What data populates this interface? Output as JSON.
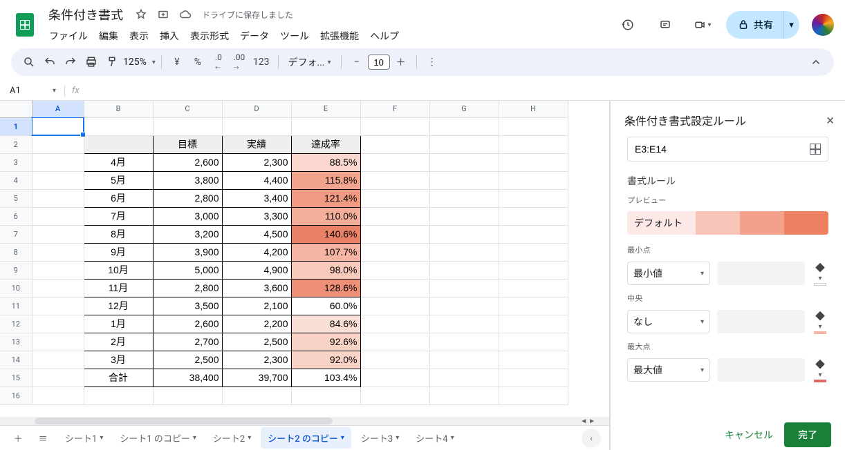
{
  "header": {
    "doc_title": "条件付き書式",
    "drive_status": "ドライブに保存しました",
    "menus": [
      "ファイル",
      "編集",
      "表示",
      "挿入",
      "表示形式",
      "データ",
      "ツール",
      "拡張機能",
      "ヘルプ"
    ],
    "share_label": "共有"
  },
  "toolbar": {
    "zoom": "125%",
    "currency": "¥",
    "percent": "%",
    "dec_dec": ".0",
    "inc_dec": ".00",
    "format123": "123",
    "font": "デフォ...",
    "font_size": "10"
  },
  "namebox": {
    "cell": "A1",
    "fx": "fx"
  },
  "columns": [
    "A",
    "B",
    "C",
    "D",
    "E",
    "F",
    "G",
    "H"
  ],
  "col_widths": {
    "A": 75,
    "B": 100,
    "C": 100,
    "D": 100,
    "E": 100,
    "F": 100,
    "G": 100,
    "H": 100
  },
  "row_count": 16,
  "selected_cell": "A1",
  "table": {
    "headers": {
      "C": "目標",
      "D": "実績",
      "E": "達成率"
    },
    "header_row": 2,
    "data_start_row": 3,
    "rows": [
      {
        "b": "4月",
        "c": "2,600",
        "d": "2,300",
        "e": "88.5%",
        "shade": "#f9d7ce"
      },
      {
        "b": "5月",
        "c": "3,800",
        "d": "4,400",
        "e": "115.8%",
        "shade": "#f2a48f"
      },
      {
        "b": "6月",
        "c": "2,800",
        "d": "3,400",
        "e": "121.4%",
        "shade": "#f09a83"
      },
      {
        "b": "7月",
        "c": "3,000",
        "d": "3,300",
        "e": "110.0%",
        "shade": "#f4af9b"
      },
      {
        "b": "8月",
        "c": "3,200",
        "d": "4,500",
        "e": "140.6%",
        "shade": "#ea8267"
      },
      {
        "b": "9月",
        "c": "3,900",
        "d": "4,200",
        "e": "107.7%",
        "shade": "#f5b5a2"
      },
      {
        "b": "10月",
        "c": "5,000",
        "d": "4,900",
        "e": "98.0%",
        "shade": "#f8cabb"
      },
      {
        "b": "11月",
        "c": "2,800",
        "d": "3,600",
        "e": "128.6%",
        "shade": "#ee9078"
      },
      {
        "b": "12月",
        "c": "3,500",
        "d": "2,100",
        "e": "60.0%",
        "shade": "#ffffff"
      },
      {
        "b": "1月",
        "c": "2,600",
        "d": "2,200",
        "e": "84.6%",
        "shade": "#fadfd6"
      },
      {
        "b": "2月",
        "c": "2,700",
        "d": "2,500",
        "e": "92.6%",
        "shade": "#f9d2c6"
      },
      {
        "b": "3月",
        "c": "2,500",
        "d": "2,300",
        "e": "92.0%",
        "shade": "#f9d3c7"
      },
      {
        "b": "合計",
        "c": "38,400",
        "d": "39,700",
        "e": "103.4%",
        "shade": "#ffffff"
      }
    ]
  },
  "sheet_tabs": [
    {
      "label": "シート1",
      "active": false
    },
    {
      "label": "シート1 のコピー",
      "active": false
    },
    {
      "label": "シート2",
      "active": false
    },
    {
      "label": "シート2 のコピー",
      "active": true
    },
    {
      "label": "シート3",
      "active": false
    },
    {
      "label": "シート4",
      "active": false
    }
  ],
  "sidebar": {
    "title": "条件付き書式設定ルール",
    "range": "E3:E14",
    "rule_section": "書式ルール",
    "preview_label": "プレビュー",
    "default_label": "デフォルト",
    "gradient": [
      "#fce8e6",
      "#f8c4b8",
      "#f3a18d",
      "#ee8062"
    ],
    "min_label": "最小点",
    "min_select": "最小値",
    "mid_label": "中央",
    "mid_select": "なし",
    "max_label": "最大点",
    "max_select": "最大値",
    "paint_colors": {
      "min": "#ffffff",
      "mid": "#f3b6a6",
      "max": "#e06666"
    },
    "cancel": "キャンセル",
    "done": "完了"
  }
}
